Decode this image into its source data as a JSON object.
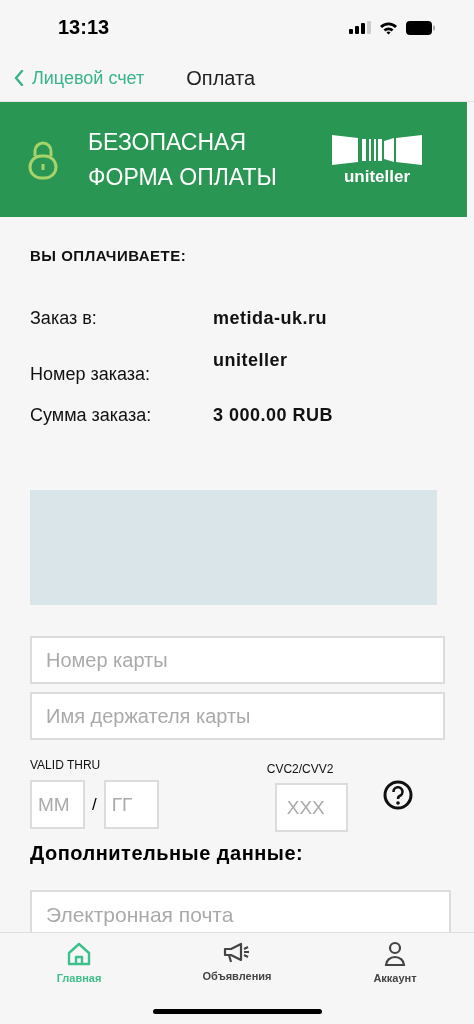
{
  "status_bar": {
    "time": "13:13"
  },
  "nav": {
    "back": "Лицевой счет",
    "title": "Оплата"
  },
  "banner": {
    "title_lines": [
      "БЕЗОПАСНАЯ",
      "ФОРМА ОПЛАТЫ"
    ],
    "logo_text": "uniteller"
  },
  "order": {
    "heading": "ВЫ ОПЛАЧИВАЕТЕ:",
    "rows": [
      {
        "label": "Заказ в:",
        "value": "metida-uk.ru"
      },
      {
        "label": "Номер заказа:",
        "value": "uniteller"
      },
      {
        "label": "Сумма заказа:",
        "value": "3 000.00 RUB"
      }
    ]
  },
  "card": {
    "number_placeholder": "Номер карты",
    "holder_placeholder": "Имя держателя карты",
    "valid_label": "VALID THRU",
    "month_placeholder": "ММ",
    "separator": "/",
    "year_placeholder": "ГГ",
    "cvc_label": "CVC2/CVV2",
    "cvc_placeholder": "XXX"
  },
  "extra": {
    "heading": "Дополнительные данные:",
    "email_placeholder": "Электронная почта"
  },
  "tabs": [
    {
      "label": "Главная",
      "kind": "home",
      "selected": true
    },
    {
      "label": "Объявления",
      "kind": "megaphone",
      "selected": false
    },
    {
      "label": "Аккаунт",
      "kind": "person",
      "selected": false
    }
  ]
}
